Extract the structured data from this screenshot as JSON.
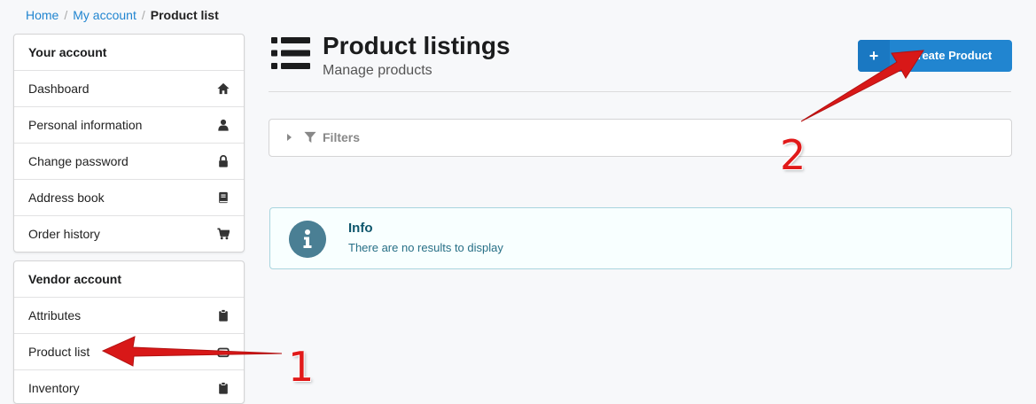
{
  "breadcrumb": {
    "home": "Home",
    "account": "My account",
    "current": "Product list",
    "separator": "/"
  },
  "account_menu": {
    "header": "Your account",
    "items": [
      {
        "label": "Dashboard",
        "icon": "home-icon"
      },
      {
        "label": "Personal information",
        "icon": "user-icon"
      },
      {
        "label": "Change password",
        "icon": "lock-icon"
      },
      {
        "label": "Address book",
        "icon": "book-icon"
      },
      {
        "label": "Order history",
        "icon": "cart-icon"
      }
    ]
  },
  "vendor_menu": {
    "header": "Vendor account",
    "items": [
      {
        "label": "Attributes",
        "icon": "clipboard-icon"
      },
      {
        "label": "Product list",
        "icon": "box-icon"
      },
      {
        "label": "Inventory",
        "icon": "clipboard-icon"
      }
    ]
  },
  "page": {
    "title": "Product listings",
    "subtitle": "Manage products"
  },
  "create_button": {
    "icon": "+",
    "label": "Create Product",
    "color": "#2185d0"
  },
  "filters": {
    "label": "Filters"
  },
  "info": {
    "title": "Info",
    "message": "There are no results to display"
  },
  "annotations": {
    "one": "1",
    "two": "2",
    "arrow_color": "#e11a1a"
  }
}
